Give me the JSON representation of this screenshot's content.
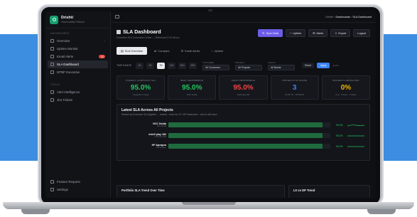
{
  "colors": {
    "background_band": "#3d8ee0",
    "accent": "#6c5ce7",
    "success": "#22c55e",
    "danger": "#ef4444",
    "warning": "#eab308",
    "info": "#3b82f6"
  },
  "sidebar": {
    "brand": {
      "name": "Drishti",
      "subtitle": "Observability Platform"
    },
    "dashboards_label": "DASHBOARDS",
    "items": [
      {
        "label": "Overview",
        "icon": "grid-icon"
      },
      {
        "label": "Uptime Monitor",
        "icon": "pulse-icon"
      },
      {
        "label": "Email Alerts",
        "icon": "mail-icon",
        "badge": "13"
      },
      {
        "label": "SLA Dashboard",
        "icon": "gauge-icon"
      },
      {
        "label": "MTBF Executive",
        "icon": "clock-icon"
      }
    ],
    "tools_label": "TOOLS",
    "tools": [
      {
        "label": "Alert Intelligence",
        "icon": "bolt-icon"
      },
      {
        "label": "Jira Tickets",
        "icon": "ticket-icon"
      }
    ],
    "bottom": [
      {
        "label": "Feature Request",
        "icon": "lightbulb-icon"
      },
      {
        "label": "Settings",
        "icon": "gear-icon"
      }
    ]
  },
  "topbar": {
    "crumb_root": "Drishti",
    "crumb_mid": "Dashboards",
    "crumb_current": "SLA Dashboard"
  },
  "header": {
    "title": "SLA Dashboard",
    "subtitle": "Executive SLA Command Center — Refreshed 2:32:48 pm",
    "buttons": {
      "sync": "Sync Data",
      "uptime": "Uptime",
      "alerts": "Alerts",
      "export": "Export",
      "logout": "Logout"
    }
  },
  "tabs": [
    "SLA Overview",
    "Compare",
    "Email Alerts",
    "Uptime"
  ],
  "filters": {
    "time_range_label": "TIME RANGE",
    "ranges": [
      "1D",
      "3D",
      "7D",
      "14D",
      "30D",
      "90D"
    ],
    "selected_range": "7D",
    "customer_label": "CUSTOMER",
    "customer_value": "All Customers",
    "project_label": "PROJECT",
    "project_value": "All Projects",
    "vaults_label": "VAULTS",
    "vaults_value": "All Bands",
    "reset": "Reset",
    "apply": "Apply",
    "live": "● 15 s"
  },
  "kpis": [
    {
      "label": "OVERALL PORTFOLIO SLA",
      "value": "95.0%",
      "sub": "3 projects in scope",
      "color": "#22c55e"
    },
    {
      "label": "BEST PERFORMING",
      "value": "95.0%",
      "sub": "NCC Noida",
      "color": "#22c55e"
    },
    {
      "label": "LEAST PERFORMING",
      "value": "95.0%",
      "sub": "Intelli play 182",
      "color": "#ef4444"
    },
    {
      "label": "PROJECTS IN SCOPE",
      "value": "3",
      "sub": "LS 86.7% · DP 98.0%",
      "color": "#3b82f6"
    },
    {
      "label": "PROJECTS IMPROVING",
      "value": "0%",
      "sub": "0 up · 0 down · 3 stable",
      "color": "#eab308"
    }
  ],
  "latest": {
    "title": "Latest SLA Across All Projects",
    "subtitle": "Ranked by Executive SLA (highest → lowest) · hover for LS / DP breakdown · click to drill down",
    "rows": [
      {
        "name": "NCC Noida",
        "sub": "NCC Noida",
        "value": "95.0%",
        "fraction": 0.95
      },
      {
        "name": "Intelli play 182",
        "sub": "Intelli play 182",
        "value": "95.0%",
        "fraction": 0.95
      },
      {
        "name": "HP Apnapra",
        "sub": "HP Apnapra",
        "value": "95.0%",
        "fraction": 0.95
      }
    ]
  },
  "bottom_cards": {
    "trend": "Portfolio SLA Trend Over Time",
    "lsdp": "LS vs DP Trend"
  }
}
